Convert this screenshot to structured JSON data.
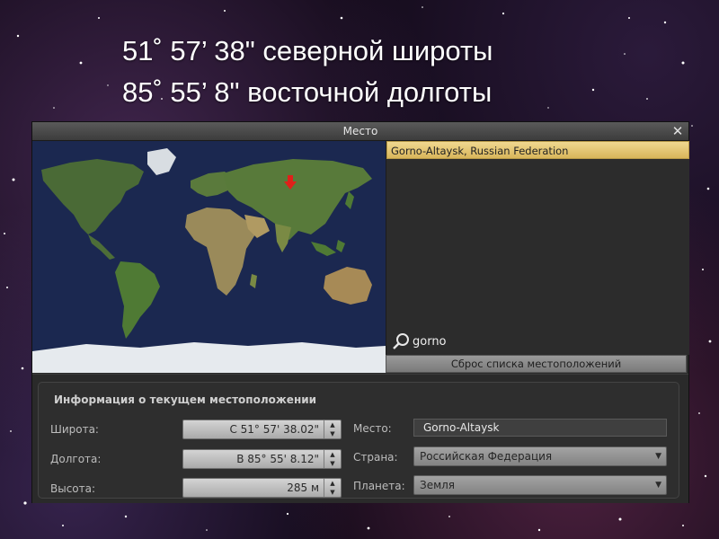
{
  "slide": {
    "line1": "51˚ 57’ 38\" северной широты",
    "line2": "85˚ 55’ 8\" восточной долготы"
  },
  "window": {
    "title": "Место",
    "close_icon": "close-icon"
  },
  "location_list": {
    "items": [
      "Gorno-Altaysk, Russian Federation"
    ],
    "selected_index": 0
  },
  "search": {
    "icon": "search-icon",
    "value": "gorno"
  },
  "reset_button": "Сброс списка местоположений",
  "map": {
    "marker": "location-marker-icon",
    "marker_lon": 85.9,
    "marker_lat": 52.0
  },
  "info": {
    "title": "Информация о текущем местоположении",
    "latitude_label": "Широта:",
    "latitude_value": "С 51° 57' 38.02\"",
    "longitude_label": "Долгота:",
    "longitude_value": "В 85° 55' 8.12\"",
    "altitude_label": "Высота:",
    "altitude_value": "285 м",
    "place_label": "Место:",
    "place_value": "Gorno-Altaysk",
    "country_label": "Страна:",
    "country_value": "Российская Федерация",
    "planet_label": "Планета:",
    "planet_value": "Земля"
  },
  "colors": {
    "selected_item": "#e3c26b",
    "ocean": "#1b2850",
    "marker": "#e0201a"
  }
}
